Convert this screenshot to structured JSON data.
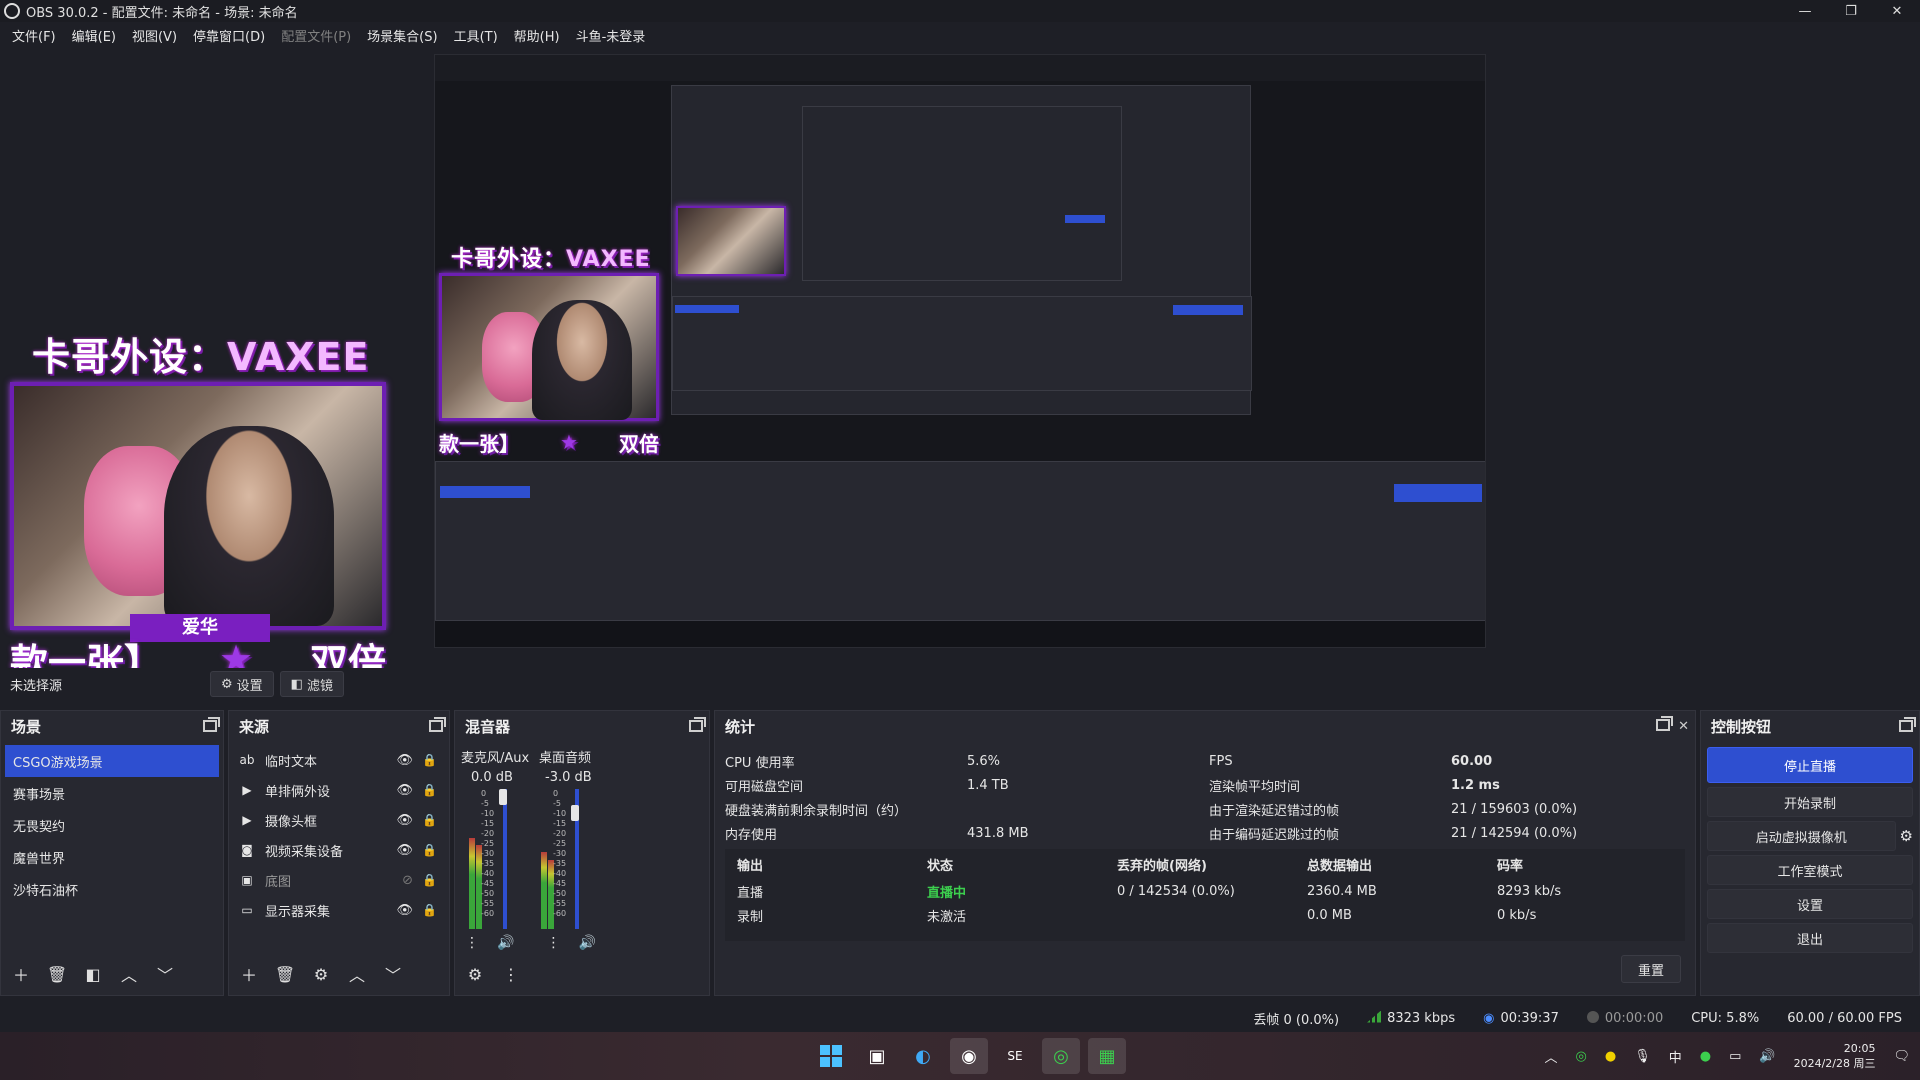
{
  "window": {
    "title": "OBS 30.0.2 - 配置文件: 未命名 - 场景: 未命名",
    "controls": [
      "—",
      "❐",
      "✕"
    ]
  },
  "menu": [
    {
      "label": "文件(F)",
      "disabled": false
    },
    {
      "label": "编辑(E)",
      "disabled": false
    },
    {
      "label": "视图(V)",
      "disabled": false
    },
    {
      "label": "停靠窗口(D)",
      "disabled": false
    },
    {
      "label": "配置文件(P)",
      "disabled": true
    },
    {
      "label": "场景集合(S)",
      "disabled": false
    },
    {
      "label": "工具(T)",
      "disabled": false
    },
    {
      "label": "帮助(H)",
      "disabled": false
    },
    {
      "label": "斗鱼-未登录",
      "disabled": false
    }
  ],
  "preview": {
    "overlay_title_cn": "卡哥外设：",
    "overlay_title_en": "VAXEE",
    "nametag": "爱华",
    "banner_left": "款一张】",
    "banner_star": "★",
    "banner_right": "双倍"
  },
  "source_toolbar": {
    "no_source": "未选择源",
    "settings": "设置",
    "filters": "滤镜"
  },
  "scenes": {
    "title": "场景",
    "items": [
      "CSGO游戏场景",
      "赛事场景",
      "无畏契约",
      "魔兽世界",
      "沙特石油杯"
    ],
    "selected": 0
  },
  "sources": {
    "title": "来源",
    "items": [
      {
        "label": "临时文本",
        "icon": "text-icon",
        "glyph": "ab",
        "hidden": false
      },
      {
        "label": "单排俩外设",
        "icon": "media-icon",
        "glyph": "▶",
        "hidden": false
      },
      {
        "label": "摄像头框",
        "icon": "media-icon",
        "glyph": "▶",
        "hidden": false
      },
      {
        "label": "视频采集设备",
        "icon": "camera-icon",
        "glyph": "◙",
        "hidden": false
      },
      {
        "label": "底图",
        "icon": "image-icon",
        "glyph": "▣",
        "hidden": true
      },
      {
        "label": "显示器采集",
        "icon": "monitor-icon",
        "glyph": "▭",
        "hidden": false
      }
    ]
  },
  "mixer": {
    "title": "混音器",
    "channels": [
      {
        "name": "麦克风/Aux",
        "db": "0.0 dB",
        "level": 0.65
      },
      {
        "name": "桌面音频",
        "db": "-3.0 dB",
        "level": 0.55
      }
    ],
    "scale": [
      "0",
      "-5",
      "-10",
      "-15",
      "-20",
      "-25",
      "-30",
      "-35",
      "-40",
      "-45",
      "-50",
      "-55",
      "-60"
    ]
  },
  "stats": {
    "title": "统计",
    "left": [
      {
        "k": "CPU 使用率",
        "v": "5.6%"
      },
      {
        "k": "可用磁盘空间",
        "v": "1.4 TB"
      },
      {
        "k": "硬盘装满前剩余录制时间（约）",
        "v": ""
      },
      {
        "k": "内存使用",
        "v": "431.8 MB"
      }
    ],
    "right": [
      {
        "k": "FPS",
        "v": "60.00",
        "bold": true
      },
      {
        "k": "渲染帧平均时间",
        "v": "1.2 ms",
        "bold": true
      },
      {
        "k": "由于渲染延迟错过的帧",
        "v": "21 / 159603 (0.0%)",
        "bold": false
      },
      {
        "k": "由于编码延迟跳过的帧",
        "v": "21 / 142594 (0.0%)",
        "bold": false
      }
    ],
    "output_headers": [
      "输出",
      "状态",
      "丢弃的帧(网络)",
      "总数据输出",
      "码率"
    ],
    "outputs": [
      {
        "name": "直播",
        "status": "直播中",
        "dropped": "0 / 142534 (0.0%)",
        "total": "2360.4 MB",
        "bitrate": "8293 kb/s",
        "active": true
      },
      {
        "name": "录制",
        "status": "未激活",
        "dropped": "",
        "total": "0.0 MB",
        "bitrate": "0 kb/s",
        "active": false
      }
    ],
    "reset": "重置"
  },
  "controls": {
    "title": "控制按钮",
    "stop_stream": "停止直播",
    "start_record": "开始录制",
    "virtual_cam": "启动虚拟摄像机",
    "studio_mode": "工作室模式",
    "settings": "设置",
    "exit": "退出"
  },
  "statusbar": {
    "dropped": "丢帧 0 (0.0%)",
    "bitrate": "8323 kbps",
    "stream_time": "00:39:37",
    "record_time": "00:00:00",
    "cpu": "CPU: 5.8%",
    "fps": "60.00 / 60.00 FPS"
  },
  "taskbar": {
    "ime": "中",
    "time": "20:05",
    "date": "2024/2/28 周三"
  },
  "colors": {
    "accent": "#2e4fd0",
    "live": "#3ccf4e",
    "panel": "#272830",
    "background": "#1e1f26"
  }
}
